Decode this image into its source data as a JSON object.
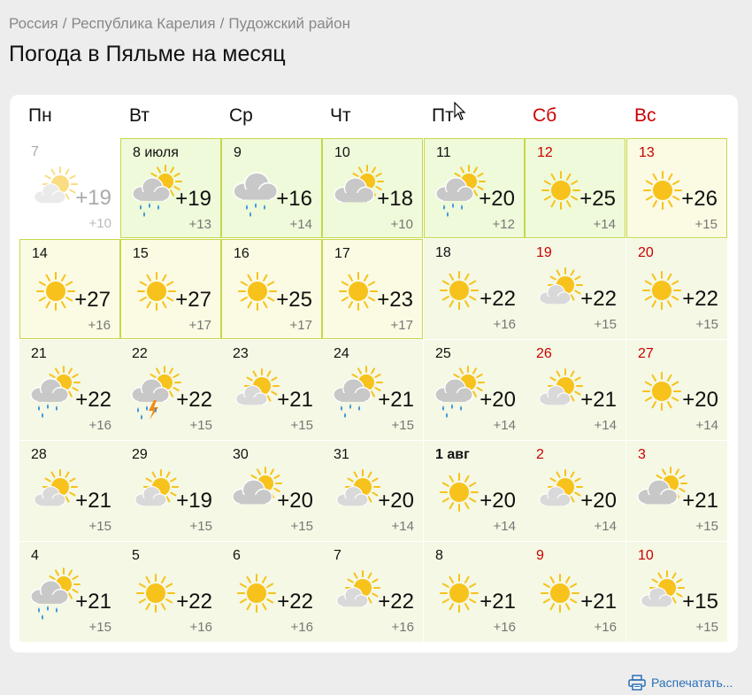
{
  "breadcrumb": {
    "items": [
      "Россия",
      "Республика Карелия",
      "Пудожский район"
    ],
    "separator": "/"
  },
  "title": "Погода в Пяльме на месяц",
  "weekdays": [
    {
      "label": "Пн",
      "weekend": false
    },
    {
      "label": "Вт",
      "weekend": false
    },
    {
      "label": "Ср",
      "weekend": false
    },
    {
      "label": "Чт",
      "weekend": false
    },
    {
      "label": "Пт",
      "weekend": false
    },
    {
      "label": "Сб",
      "weekend": true
    },
    {
      "label": "Вс",
      "weekend": true
    }
  ],
  "days": [
    {
      "date": "7",
      "icon": "partly-cloudy-icon",
      "max": "+19",
      "min": "+10",
      "past": true
    },
    {
      "date": "8 июля",
      "icon": "cloud-sun-rain-icon",
      "max": "+19",
      "min": "+13",
      "highlight": "green"
    },
    {
      "date": "9",
      "icon": "cloud-rain-icon",
      "max": "+16",
      "min": "+14",
      "highlight": "green"
    },
    {
      "date": "10",
      "icon": "cloudy-sun-icon",
      "max": "+18",
      "min": "+10",
      "highlight": "green"
    },
    {
      "date": "11",
      "icon": "cloud-sun-rain-icon",
      "max": "+20",
      "min": "+12",
      "highlight": "green"
    },
    {
      "date": "12",
      "icon": "sun-icon",
      "max": "+25",
      "min": "+14",
      "weekend": true,
      "highlight": "green"
    },
    {
      "date": "13",
      "icon": "sun-icon",
      "max": "+26",
      "min": "+15",
      "weekend": true,
      "highlight": "yellow"
    },
    {
      "date": "14",
      "icon": "sun-icon",
      "max": "+27",
      "min": "+16",
      "highlight": "yellow"
    },
    {
      "date": "15",
      "icon": "sun-icon",
      "max": "+27",
      "min": "+17",
      "highlight": "yellow"
    },
    {
      "date": "16",
      "icon": "sun-icon",
      "max": "+25",
      "min": "+17",
      "highlight": "yellow"
    },
    {
      "date": "17",
      "icon": "sun-icon",
      "max": "+23",
      "min": "+17",
      "highlight": "yellow"
    },
    {
      "date": "18",
      "icon": "sun-icon",
      "max": "+22",
      "min": "+16"
    },
    {
      "date": "19",
      "icon": "partly-cloudy-icon",
      "max": "+22",
      "min": "+15",
      "weekend": true
    },
    {
      "date": "20",
      "icon": "sun-icon",
      "max": "+22",
      "min": "+15",
      "weekend": true
    },
    {
      "date": "21",
      "icon": "cloud-sun-rain-icon",
      "max": "+22",
      "min": "+16"
    },
    {
      "date": "22",
      "icon": "thunderstorm-icon",
      "max": "+22",
      "min": "+15"
    },
    {
      "date": "23",
      "icon": "partly-cloudy-icon",
      "max": "+21",
      "min": "+15"
    },
    {
      "date": "24",
      "icon": "cloud-sun-rain-icon",
      "max": "+21",
      "min": "+15"
    },
    {
      "date": "25",
      "icon": "cloud-sun-rain-icon",
      "max": "+20",
      "min": "+14"
    },
    {
      "date": "26",
      "icon": "partly-cloudy-icon",
      "max": "+21",
      "min": "+14",
      "weekend": true
    },
    {
      "date": "27",
      "icon": "sun-icon",
      "max": "+20",
      "min": "+14",
      "weekend": true
    },
    {
      "date": "28",
      "icon": "partly-cloudy-icon",
      "max": "+21",
      "min": "+15"
    },
    {
      "date": "29",
      "icon": "partly-cloudy-icon",
      "max": "+19",
      "min": "+15"
    },
    {
      "date": "30",
      "icon": "cloudy-sun-icon",
      "max": "+20",
      "min": "+15"
    },
    {
      "date": "31",
      "icon": "partly-cloudy-icon",
      "max": "+20",
      "min": "+14"
    },
    {
      "date": "1 авг",
      "icon": "sun-icon",
      "max": "+20",
      "min": "+14",
      "bold": true
    },
    {
      "date": "2",
      "icon": "partly-cloudy-icon",
      "max": "+20",
      "min": "+14",
      "weekend": true
    },
    {
      "date": "3",
      "icon": "cloudy-sun-icon",
      "max": "+21",
      "min": "+15",
      "weekend": true
    },
    {
      "date": "4",
      "icon": "cloud-sun-rain-icon",
      "max": "+21",
      "min": "+15"
    },
    {
      "date": "5",
      "icon": "sun-icon",
      "max": "+22",
      "min": "+16"
    },
    {
      "date": "6",
      "icon": "sun-icon",
      "max": "+22",
      "min": "+16"
    },
    {
      "date": "7",
      "icon": "partly-cloudy-icon",
      "max": "+22",
      "min": "+16"
    },
    {
      "date": "8",
      "icon": "sun-icon",
      "max": "+21",
      "min": "+16"
    },
    {
      "date": "9",
      "icon": "sun-icon",
      "max": "+21",
      "min": "+16",
      "weekend": true
    },
    {
      "date": "10",
      "icon": "partly-cloudy-icon",
      "max": "+15",
      "min": "+15",
      "weekend": true
    }
  ],
  "print_label": "Распечатать...",
  "colors": {
    "weekend": "#cc0000",
    "highlight_border": "#c5d84b",
    "sun": "#f7c21b",
    "link": "#2a6fb6"
  }
}
